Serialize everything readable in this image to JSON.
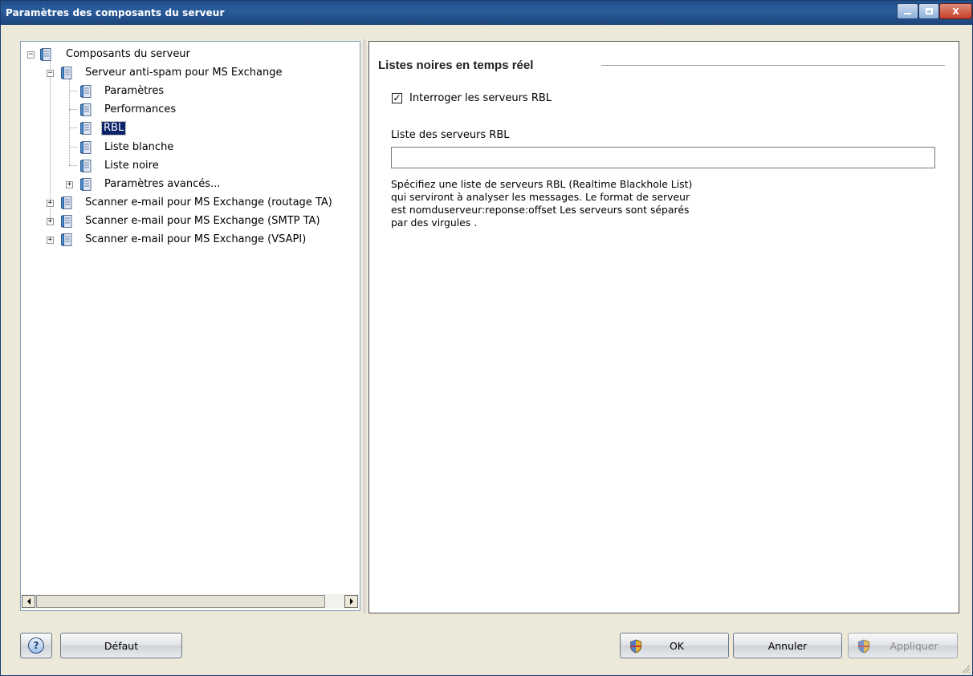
{
  "window": {
    "title": "Paramètres des composants du serveur"
  },
  "titlebar": {
    "minimize": "—",
    "maximize": "☐",
    "close": "X"
  },
  "tree": {
    "root": "Composants du serveur",
    "antispam": "Serveur anti-spam pour MS Exchange",
    "children": [
      "Paramètres",
      "Performances",
      "RBL",
      "Liste blanche",
      "Liste noire"
    ],
    "advanced": "Paramètres avancés...",
    "scanner_routage": "Scanner e-mail pour MS Exchange (routage TA)",
    "scanner_smtp": "Scanner e-mail pour MS Exchange (SMTP TA)",
    "scanner_vsapi": "Scanner e-mail pour MS Exchange (VSAPI)",
    "selected": "RBL"
  },
  "content": {
    "section_title": "Listes noires en temps réel",
    "checkbox_label": "Interroger les serveurs RBL",
    "checkbox_checked": true,
    "field_label": "Liste des serveurs RBL",
    "field_value": "",
    "help_lines": [
      "Spécifiez une liste de serveurs RBL (Realtime Blackhole List)",
      "qui serviront à analyser les messages. Le format  de serveur",
      "est nomduserveur:reponse:offset Les serveurs sont séparés",
      "par des virgules ."
    ]
  },
  "footer": {
    "help": "?",
    "default": "Défaut",
    "ok": "OK",
    "cancel": "Annuler",
    "apply": "Appliquer"
  },
  "colors": {
    "selection": "#0a246a",
    "titlebar": "#2a5d9c"
  }
}
